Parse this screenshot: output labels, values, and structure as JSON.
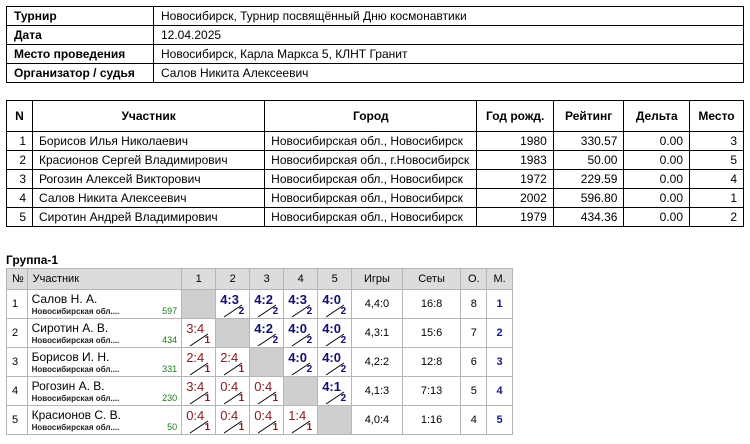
{
  "info": [
    {
      "label": "Турнир",
      "value": "Новосибирск, Турнир посвящённый Дню космонавтики"
    },
    {
      "label": "Дата",
      "value": "12.04.2025"
    },
    {
      "label": "Место проведения",
      "value": "Новосибирск, Карла Маркса 5, КЛНТ Гранит"
    },
    {
      "label": "Организатор / судья",
      "value": "Салов Никита Алексеевич"
    }
  ],
  "players_table": {
    "headers": [
      "N",
      "Участник",
      "Город",
      "Год рожд.",
      "Рейтинг",
      "Дельта",
      "Место"
    ],
    "rows": [
      {
        "n": "1",
        "name": "Борисов Илья Николаевич",
        "city": "Новосибирская обл., Новосибирск",
        "year": "1980",
        "rating": "330.57",
        "delta": "0.00",
        "place": "3"
      },
      {
        "n": "2",
        "name": "Красионов Сергей Владимирович",
        "city": "Новосибирская обл., г.Новосибирск",
        "year": "1983",
        "rating": "50.00",
        "delta": "0.00",
        "place": "5"
      },
      {
        "n": "3",
        "name": "Рогозин Алексей Викторович",
        "city": "Новосибирская обл., Новосибирск",
        "year": "1972",
        "rating": "229.59",
        "delta": "0.00",
        "place": "4"
      },
      {
        "n": "4",
        "name": "Салов Никита Алексеевич",
        "city": "Новосибирская обл., Новосибирск",
        "year": "2002",
        "rating": "596.80",
        "delta": "0.00",
        "place": "1"
      },
      {
        "n": "5",
        "name": "Сиротин Андрей Владимирович",
        "city": "Новосибирская обл., Новосибирск",
        "year": "1979",
        "rating": "434.36",
        "delta": "0.00",
        "place": "2"
      }
    ]
  },
  "group": {
    "title": "Группа-1",
    "headers": [
      "№",
      "Участник",
      "1",
      "2",
      "3",
      "4",
      "5",
      "Игры",
      "Сеты",
      "О.",
      "М."
    ],
    "rows": [
      {
        "n": "1",
        "name": "Салов Н. А.",
        "region": "Новосибирская обл....",
        "rating": "597",
        "results": [
          null,
          {
            "s": "4:3",
            "p": "2",
            "win": true
          },
          {
            "s": "4:2",
            "p": "2",
            "win": true
          },
          {
            "s": "4:3",
            "p": "2",
            "win": true
          },
          {
            "s": "4:0",
            "p": "2",
            "win": true
          }
        ],
        "games": "4,4:0",
        "sets": "16:8",
        "points": "8",
        "place": "1"
      },
      {
        "n": "2",
        "name": "Сиротин А. В.",
        "region": "Новосибирская обл....",
        "rating": "434",
        "results": [
          {
            "s": "3:4",
            "p": "1",
            "win": false
          },
          null,
          {
            "s": "4:2",
            "p": "2",
            "win": true
          },
          {
            "s": "4:0",
            "p": "2",
            "win": true
          },
          {
            "s": "4:0",
            "p": "2",
            "win": true
          }
        ],
        "games": "4,3:1",
        "sets": "15:6",
        "points": "7",
        "place": "2"
      },
      {
        "n": "3",
        "name": "Борисов И. Н.",
        "region": "Новосибирская обл....",
        "rating": "331",
        "results": [
          {
            "s": "2:4",
            "p": "1",
            "win": false
          },
          {
            "s": "2:4",
            "p": "1",
            "win": false
          },
          null,
          {
            "s": "4:0",
            "p": "2",
            "win": true
          },
          {
            "s": "4:0",
            "p": "2",
            "win": true
          }
        ],
        "games": "4,2:2",
        "sets": "12:8",
        "points": "6",
        "place": "3"
      },
      {
        "n": "4",
        "name": "Рогозин А. В.",
        "region": "Новосибирская обл....",
        "rating": "230",
        "results": [
          {
            "s": "3:4",
            "p": "1",
            "win": false
          },
          {
            "s": "0:4",
            "p": "1",
            "win": false
          },
          {
            "s": "0:4",
            "p": "1",
            "win": false
          },
          null,
          {
            "s": "4:1",
            "p": "2",
            "win": true
          }
        ],
        "games": "4,1:3",
        "sets": "7:13",
        "points": "5",
        "place": "4"
      },
      {
        "n": "5",
        "name": "Красионов С. В.",
        "region": "Новосибирская обл....",
        "rating": "50",
        "results": [
          {
            "s": "0:4",
            "p": "1",
            "win": false
          },
          {
            "s": "0:4",
            "p": "1",
            "win": false
          },
          {
            "s": "0:4",
            "p": "1",
            "win": false
          },
          {
            "s": "1:4",
            "p": "1",
            "win": false
          },
          null
        ],
        "games": "4,0:4",
        "sets": "1:16",
        "points": "4",
        "place": "5"
      }
    ]
  }
}
